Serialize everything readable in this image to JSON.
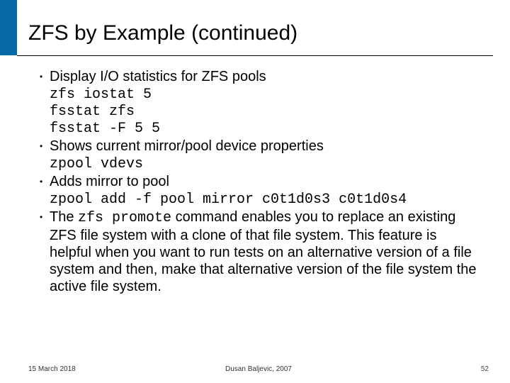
{
  "title": "ZFS by Example (continued)",
  "bullets": [
    {
      "text": "Display I/O statistics for ZFS pools"
    },
    {
      "text": "Shows current mirror/pool device properties"
    },
    {
      "text": "Adds mirror to pool"
    }
  ],
  "code_blocks": {
    "b0": [
      "zfs iostat 5",
      "fsstat zfs",
      "fsstat -F 5 5"
    ],
    "b1": [
      "zpool vdevs"
    ],
    "b2": [
      "zpool add -f pool mirror c0t1d0s3 c0t1d0s4"
    ]
  },
  "promote": {
    "pre": "The ",
    "cmd": "zfs promote",
    "post": " command enables you to replace an existing ZFS file system with a clone of that file system. This feature is helpful when you want to run tests on an alternative version of a file system and then, make that alternative version of the file system the active file system."
  },
  "footer": {
    "date": "15 March 2018",
    "author": "Dusan Baljevic, 2007",
    "page": "52"
  },
  "colors": {
    "accent": "#0a6aa8"
  }
}
